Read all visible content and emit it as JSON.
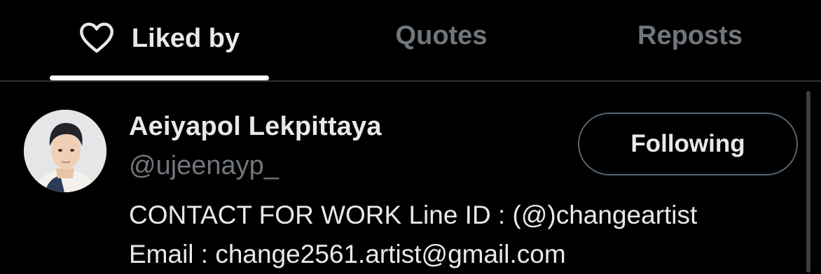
{
  "tabs": [
    {
      "label": "Liked by",
      "icon": "heart-icon",
      "active": true
    },
    {
      "label": "Quotes",
      "active": false
    },
    {
      "label": "Reposts",
      "active": false
    }
  ],
  "user": {
    "display_name": "Aeiyapol Lekpittaya",
    "handle": "@ujeenayp_",
    "avatar": "profile-photo",
    "follow_button_label": "Following",
    "bio_lines": [
      "CONTACT FOR WORK Line ID : (@)changeartist",
      "Email : change2561.artist@gmail.com"
    ]
  },
  "colors": {
    "background": "#000000",
    "text_primary": "#e7e9ea",
    "text_secondary": "#71767b",
    "divider": "#2f3336",
    "button_border": "#536471"
  }
}
